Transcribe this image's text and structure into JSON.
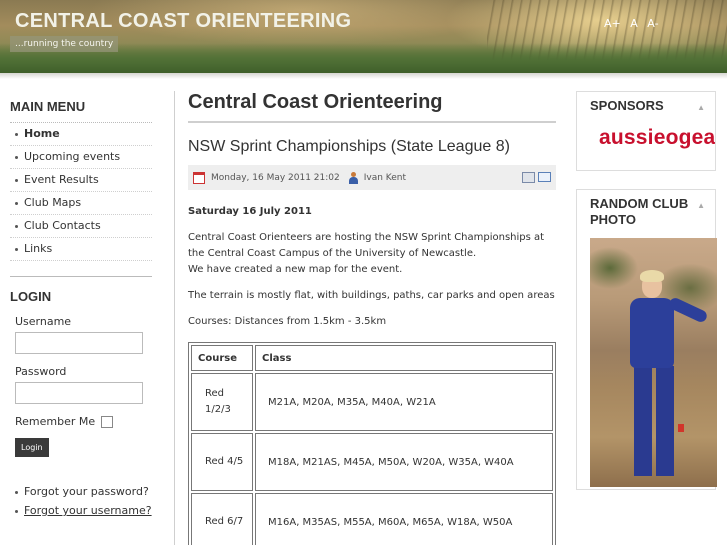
{
  "header": {
    "site_title": "CENTRAL COAST ORIENTEERING",
    "tagline": "...running the country",
    "font_sizer": [
      "A+",
      "A",
      "A-"
    ]
  },
  "main_menu": {
    "title": "MAIN MENU",
    "items": [
      {
        "label": "Home",
        "active": true
      },
      {
        "label": "Upcoming events"
      },
      {
        "label": "Event Results"
      },
      {
        "label": "Club Maps"
      },
      {
        "label": "Club Contacts"
      },
      {
        "label": "Links"
      }
    ]
  },
  "login": {
    "title": "LOGIN",
    "username_label": "Username",
    "username_value": "",
    "password_label": "Password",
    "password_value": "",
    "remember_label": "Remember Me",
    "button_label": "Login",
    "forgot_password": "Forgot your password?",
    "forgot_username": "Forgot your username?"
  },
  "content": {
    "page_title": "Central Coast Orienteering",
    "article_title": "NSW Sprint Championships (State League 8)",
    "meta_date": "Monday, 16 May 2011 21:02",
    "meta_author": "Ivan Kent",
    "event_date": "Saturday 16 July 2011",
    "para1": "Central Coast Orienteers are hosting the NSW Sprint Championships at the Central Coast Campus of the University of Newcastle.",
    "para1b": "We have created a new map for the event.",
    "para2": "The terrain is mostly flat, with buildings, paths, car parks and open areas",
    "para3": "Courses: Distances from 1.5km - 3.5km",
    "table": {
      "headers": [
        "Course",
        "Class"
      ],
      "rows": [
        {
          "course": "Red 1/2/3",
          "classes": "M21A, M20A, M35A, M40A, W21A"
        },
        {
          "course": "Red 4/5",
          "classes": "M18A, M21AS, M45A, M50A, W20A, W35A, W40A"
        },
        {
          "course": "Red 6/7",
          "classes": "M16A, M35AS, M55A, M60A, M65A, W18A, W50A"
        }
      ]
    }
  },
  "sponsors": {
    "title": "SPONSORS",
    "logo_text": "aussieogear"
  },
  "random_photo": {
    "title": "RANDOM CLUB PHOTO"
  },
  "colors": {
    "sponsor_red": "#c8102e",
    "login_button": "#3a3a3a"
  }
}
